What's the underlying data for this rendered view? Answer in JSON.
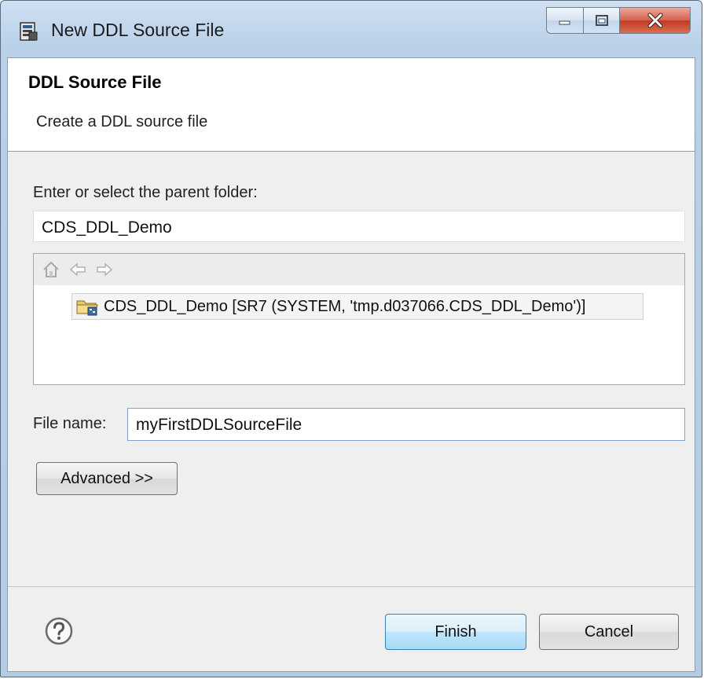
{
  "window": {
    "title": "New DDL Source File",
    "icons": {
      "app": "ddl-file-icon",
      "minimize": "minimize-icon",
      "maximize": "maximize-icon",
      "close": "close-icon"
    }
  },
  "banner": {
    "title": "DDL Source File",
    "description": "Create a DDL source file"
  },
  "parent_folder": {
    "label": "Enter or select the parent folder:",
    "value": "CDS_DDL_Demo"
  },
  "tree": {
    "toolbar_icons": [
      "home-icon",
      "back-arrow-icon",
      "forward-arrow-icon"
    ],
    "items": [
      {
        "label": "CDS_DDL_Demo [SR7 (SYSTEM, 'tmp.d037066.CDS_DDL_Demo')]",
        "icon": "project-folder-icon",
        "selected": true
      }
    ]
  },
  "file_name": {
    "label": "File name:",
    "value": "myFirstDDLSourceFile"
  },
  "buttons": {
    "advanced": "Advanced >>",
    "finish": "Finish",
    "cancel": "Cancel",
    "help_icon": "help-icon"
  },
  "colors": {
    "title_bar": "#b9d0e8",
    "close_button": "#c13a23",
    "dialog_background": "#efefef",
    "finish_button": "#bee6fd"
  }
}
